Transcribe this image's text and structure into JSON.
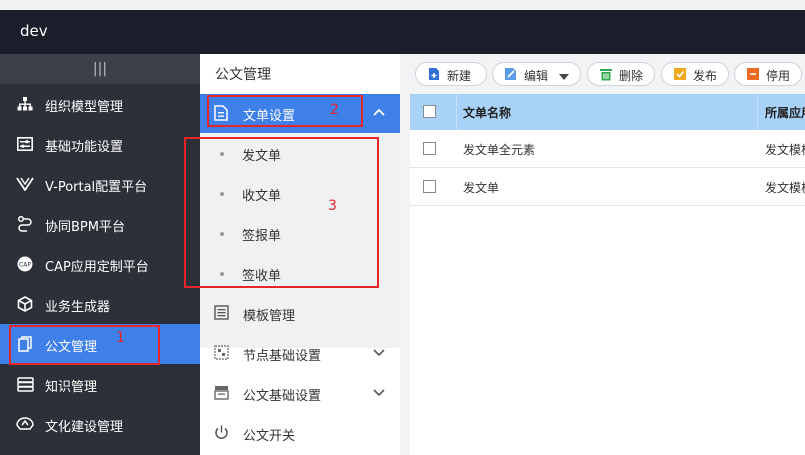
{
  "app": {
    "title": "dev"
  },
  "left_nav": {
    "collapse_glyph": "|||",
    "items": [
      {
        "label": "组织模型管理",
        "icon": "org-chart-icon"
      },
      {
        "label": "基础功能设置",
        "icon": "settings-list-icon"
      },
      {
        "label": "V-Portal配置平台",
        "icon": "portal-icon"
      },
      {
        "label": "协同BPM平台",
        "icon": "workflow-icon"
      },
      {
        "label": "CAP应用定制平台",
        "icon": "cap-icon"
      },
      {
        "label": "业务生成器",
        "icon": "cube-icon"
      },
      {
        "label": "公文管理",
        "icon": "document-copy-icon",
        "active": true
      },
      {
        "label": "知识管理",
        "icon": "knowledge-icon"
      },
      {
        "label": "文化建设管理",
        "icon": "culture-icon"
      }
    ]
  },
  "sub_nav": {
    "title": "公文管理",
    "active_group": {
      "label": "文单设置",
      "icon": "form-doc-icon",
      "expanded": true
    },
    "leaves": [
      "发文单",
      "收文单",
      "签报单",
      "签收单"
    ],
    "items": [
      {
        "label": "模板管理",
        "icon": "template-icon",
        "has_children": false
      },
      {
        "label": "节点基础设置",
        "icon": "node-settings-icon",
        "has_children": true
      },
      {
        "label": "公文基础设置",
        "icon": "doc-settings-icon",
        "has_children": true
      },
      {
        "label": "公文开关",
        "icon": "power-icon",
        "has_children": false
      }
    ]
  },
  "toolbar": {
    "new_label": "新建",
    "edit_label": "编辑",
    "delete_label": "删除",
    "publish_label": "发布",
    "disable_label": "停用"
  },
  "table": {
    "columns": [
      "文单名称",
      "所属应用"
    ],
    "rows": [
      {
        "name": "发文单全元素",
        "app": "发文模板"
      },
      {
        "name": "发文单",
        "app": "发文模板"
      }
    ]
  },
  "annotations": [
    "1",
    "2",
    "3"
  ],
  "colors": {
    "topbar": "#1b1e2b",
    "sidebar": "#2c3038",
    "accent": "#3f7fe8",
    "table_header": "#a9d2f8",
    "annotation": "#e8262a"
  }
}
